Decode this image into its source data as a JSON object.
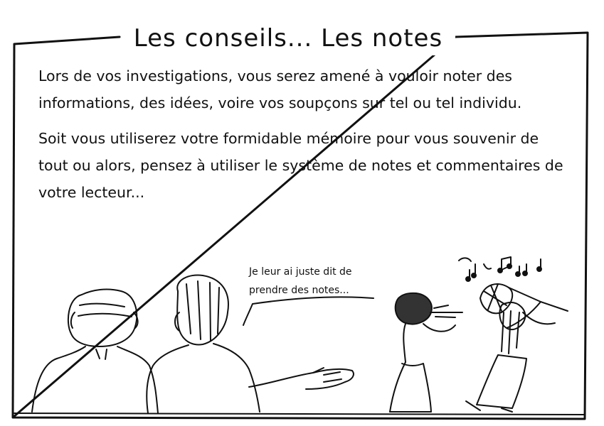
{
  "title": "Les conseils... Les notes",
  "paragraphs": [
    "Lors de vos investigations, vous serez amené à vouloir noter des informations, des idées, voire vos soupçons sur tel ou tel individu.",
    "Soit vous utiliserez votre formidable mémoire pour vous souvenir de tout ou alors, pensez à utiliser le système de notes et commentaires de votre lecteur..."
  ],
  "speech_bubble": "Je leur ai juste dit de prendre des notes...",
  "colors": {
    "ink": "#111111",
    "paper": "#ffffff"
  }
}
